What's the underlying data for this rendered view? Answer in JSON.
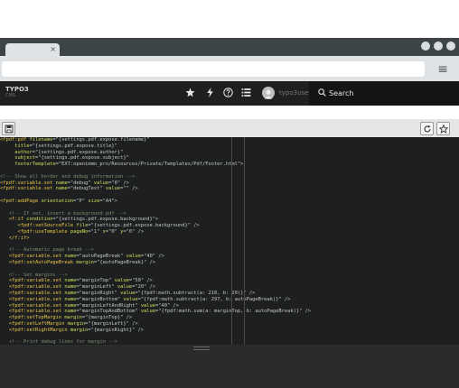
{
  "browser": {
    "tab_close": "×",
    "menu_icon": "≡"
  },
  "appbar": {
    "logo_line1": "TYPO3",
    "logo_line2": "CMS",
    "icons": [
      "star-icon",
      "lightning-icon",
      "help-icon",
      "list-icon"
    ],
    "username": "typo3user",
    "search_label": "Search"
  },
  "toolbar": {
    "save_icon": "save-icon",
    "refresh_icon": "refresh-icon",
    "bookmark_icon": "star-icon"
  },
  "code": {
    "lines": [
      [
        [
          "tag",
          "<fpdf:pdf "
        ],
        [
          "attr",
          "filename"
        ],
        [
          "p",
          "=\"{settings.pdf.expose.filename}\""
        ]
      ],
      [
        [
          "p",
          "     "
        ],
        [
          "attr",
          "title"
        ],
        [
          "p",
          "=\"{settings.pdf.expose.title}\""
        ]
      ],
      [
        [
          "p",
          "     "
        ],
        [
          "attr",
          "author"
        ],
        [
          "p",
          "=\"{settings.pdf.expose.author}\""
        ]
      ],
      [
        [
          "p",
          "     "
        ],
        [
          "attr",
          "subject"
        ],
        [
          "p",
          "=\"{settings.pdf.expose.subject}\""
        ]
      ],
      [
        [
          "p",
          "     "
        ],
        [
          "attr",
          "footerTemplate"
        ],
        [
          "p",
          "=\"EXT:openimmo_pro/Resources/Private/Templates/Pdf/Footer.html\">"
        ]
      ],
      [
        [
          "p",
          ""
        ]
      ],
      [
        [
          "c",
          "<!-- Show all border and debug information -->"
        ]
      ],
      [
        [
          "tag",
          "<fpdf:variable.set "
        ],
        [
          "attr",
          "name"
        ],
        [
          "p",
          "=\"debug\" "
        ],
        [
          "attr",
          "value"
        ],
        [
          "p",
          "=\"0\" />"
        ]
      ],
      [
        [
          "tag",
          "<fpdf:variable.set "
        ],
        [
          "attr",
          "name"
        ],
        [
          "p",
          "=\"debugText\" "
        ],
        [
          "attr",
          "value"
        ],
        [
          "p",
          "=\"\" />"
        ]
      ],
      [
        [
          "p",
          ""
        ]
      ],
      [
        [
          "tag",
          "<fpdf:addPage "
        ],
        [
          "attr",
          "orientation"
        ],
        [
          "p",
          "=\"P\" "
        ],
        [
          "attr",
          "size"
        ],
        [
          "p",
          "=\"A4\">"
        ]
      ],
      [
        [
          "p",
          ""
        ]
      ],
      [
        [
          "p",
          "   "
        ],
        [
          "c",
          "<!-- If set, insert a background pdf -->"
        ]
      ],
      [
        [
          "p",
          "   "
        ],
        [
          "tag",
          "<f:if "
        ],
        [
          "attr",
          "condition"
        ],
        [
          "p",
          "=\"{settings.pdf.expose.background}\">"
        ]
      ],
      [
        [
          "p",
          "      "
        ],
        [
          "tag",
          "<fpdf:setSourceFile "
        ],
        [
          "attr",
          "file"
        ],
        [
          "p",
          "=\"{settings.pdf.expose.background}\" />"
        ]
      ],
      [
        [
          "p",
          "      "
        ],
        [
          "tag",
          "<fpdf:useTemplate "
        ],
        [
          "attr",
          "pageNo"
        ],
        [
          "p",
          "=\"1\" "
        ],
        [
          "attr",
          "x"
        ],
        [
          "p",
          "=\"0\" "
        ],
        [
          "attr",
          "y"
        ],
        [
          "p",
          "=\"0\" />"
        ]
      ],
      [
        [
          "p",
          "   "
        ],
        [
          "tag",
          "</f:if>"
        ]
      ],
      [
        [
          "p",
          ""
        ]
      ],
      [
        [
          "p",
          "   "
        ],
        [
          "c",
          "<!-- Automatic page break -->"
        ]
      ],
      [
        [
          "p",
          "   "
        ],
        [
          "tag",
          "<fpdf:variable.set "
        ],
        [
          "attr",
          "name"
        ],
        [
          "p",
          "=\"autoPageBreak\" "
        ],
        [
          "attr",
          "value"
        ],
        [
          "p",
          "=\"40\" />"
        ]
      ],
      [
        [
          "p",
          "   "
        ],
        [
          "tag",
          "<fpdf:setAutoPageBreak "
        ],
        [
          "attr",
          "margin"
        ],
        [
          "p",
          "=\"{autoPageBreak}\" />"
        ]
      ],
      [
        [
          "p",
          ""
        ]
      ],
      [
        [
          "p",
          "   "
        ],
        [
          "c",
          "<!-- Set margins -->"
        ]
      ],
      [
        [
          "p",
          "   "
        ],
        [
          "tag",
          "<fpdf:variable.set "
        ],
        [
          "attr",
          "name"
        ],
        [
          "p",
          "=\"marginTop\" "
        ],
        [
          "attr",
          "value"
        ],
        [
          "p",
          "=\"50\" />"
        ]
      ],
      [
        [
          "p",
          "   "
        ],
        [
          "tag",
          "<fpdf:variable.set "
        ],
        [
          "attr",
          "name"
        ],
        [
          "p",
          "=\"marginLeft\" "
        ],
        [
          "attr",
          "value"
        ],
        [
          "p",
          "=\"20\" />"
        ]
      ],
      [
        [
          "p",
          "   "
        ],
        [
          "tag",
          "<fpdf:variable.set "
        ],
        [
          "attr",
          "name"
        ],
        [
          "p",
          "=\"marginRight\" "
        ],
        [
          "attr",
          "value"
        ],
        [
          "p",
          "=\"{fpdf:math.subtract(a: 210, b: 20)}\" />"
        ]
      ],
      [
        [
          "p",
          "   "
        ],
        [
          "tag",
          "<fpdf:variable.set "
        ],
        [
          "attr",
          "name"
        ],
        [
          "p",
          "=\"marginBottom\" "
        ],
        [
          "attr",
          "value"
        ],
        [
          "p",
          "=\"{fpdf:math.subtract(a: 297, b: autoPageBreak)}\" />"
        ]
      ],
      [
        [
          "p",
          "   "
        ],
        [
          "tag",
          "<fpdf:variable.set "
        ],
        [
          "attr",
          "name"
        ],
        [
          "p",
          "=\"marginLeftAndRight\" "
        ],
        [
          "attr",
          "value"
        ],
        [
          "p",
          "=\"40\" />"
        ]
      ],
      [
        [
          "p",
          "   "
        ],
        [
          "tag",
          "<fpdf:variable.set "
        ],
        [
          "attr",
          "name"
        ],
        [
          "p",
          "=\"marginTopAndBottom\" "
        ],
        [
          "attr",
          "value"
        ],
        [
          "p",
          "=\"{fpdf:math.sum(a: marginTop, b: autoPageBreak)}\" />"
        ]
      ],
      [
        [
          "p",
          "   "
        ],
        [
          "tag",
          "<fpdf:setTopMargin "
        ],
        [
          "attr",
          "margin"
        ],
        [
          "p",
          "=\"{marginTop}\" />"
        ]
      ],
      [
        [
          "p",
          "   "
        ],
        [
          "tag",
          "<fpdf:setLeftMargin "
        ],
        [
          "attr",
          "margin"
        ],
        [
          "p",
          "=\"{marginLeft}\" />"
        ]
      ],
      [
        [
          "p",
          "   "
        ],
        [
          "tag",
          "<fpdf:setRightMargin "
        ],
        [
          "attr",
          "margin"
        ],
        [
          "p",
          "=\"{marginRight}\" />"
        ]
      ],
      [
        [
          "p",
          ""
        ]
      ],
      [
        [
          "p",
          "   "
        ],
        [
          "c",
          "<!-- Print debug lines for margin -->"
        ]
      ]
    ]
  },
  "colors": {
    "tag": "#e8c547",
    "attr": "#c9e05a",
    "p": "#c5c8c6",
    "c": "#7f8c6c"
  }
}
